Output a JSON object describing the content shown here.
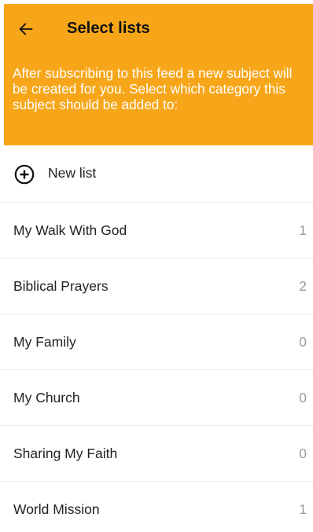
{
  "header": {
    "title": "Select lists",
    "description": "After subscribing to this feed a new subject will be created for you. Select which category this subject should be added to:",
    "back_icon": "arrow-left-icon",
    "background_color": "#F7A619"
  },
  "new_list": {
    "label": "New list",
    "icon": "plus-circle-icon"
  },
  "lists": [
    {
      "label": "My Walk With God",
      "count": "1"
    },
    {
      "label": "Biblical Prayers",
      "count": "2"
    },
    {
      "label": "My Family",
      "count": "0"
    },
    {
      "label": "My Church",
      "count": "0"
    },
    {
      "label": "Sharing My Faith",
      "count": "0"
    },
    {
      "label": "World Mission",
      "count": "1"
    }
  ]
}
